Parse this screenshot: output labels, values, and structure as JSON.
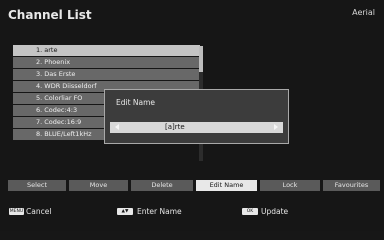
{
  "title": "Channel List",
  "source": "Aerial",
  "channels": [
    "1. arte",
    "2. Phoenix",
    "3. Das Erste",
    "4. WDR Diisseldorf",
    "5. Colorliar FO",
    "6. Codec:4:3",
    "7. Codec:16:9",
    "8. BLUE/Left1kHz"
  ],
  "selected_channel_index": 0,
  "dialog": {
    "title": "Edit Name",
    "value": "[a]rte"
  },
  "function_buttons": [
    "Select",
    "Move",
    "Delete",
    "Edit Name",
    "Lock",
    "Favourites"
  ],
  "active_function": "Edit Name",
  "hints": {
    "menu": {
      "key": "MENU",
      "label": "Cancel"
    },
    "arrows": {
      "key": "▲▼",
      "label": "Enter Name"
    },
    "ok": {
      "key": "OK",
      "label": "Update"
    }
  }
}
